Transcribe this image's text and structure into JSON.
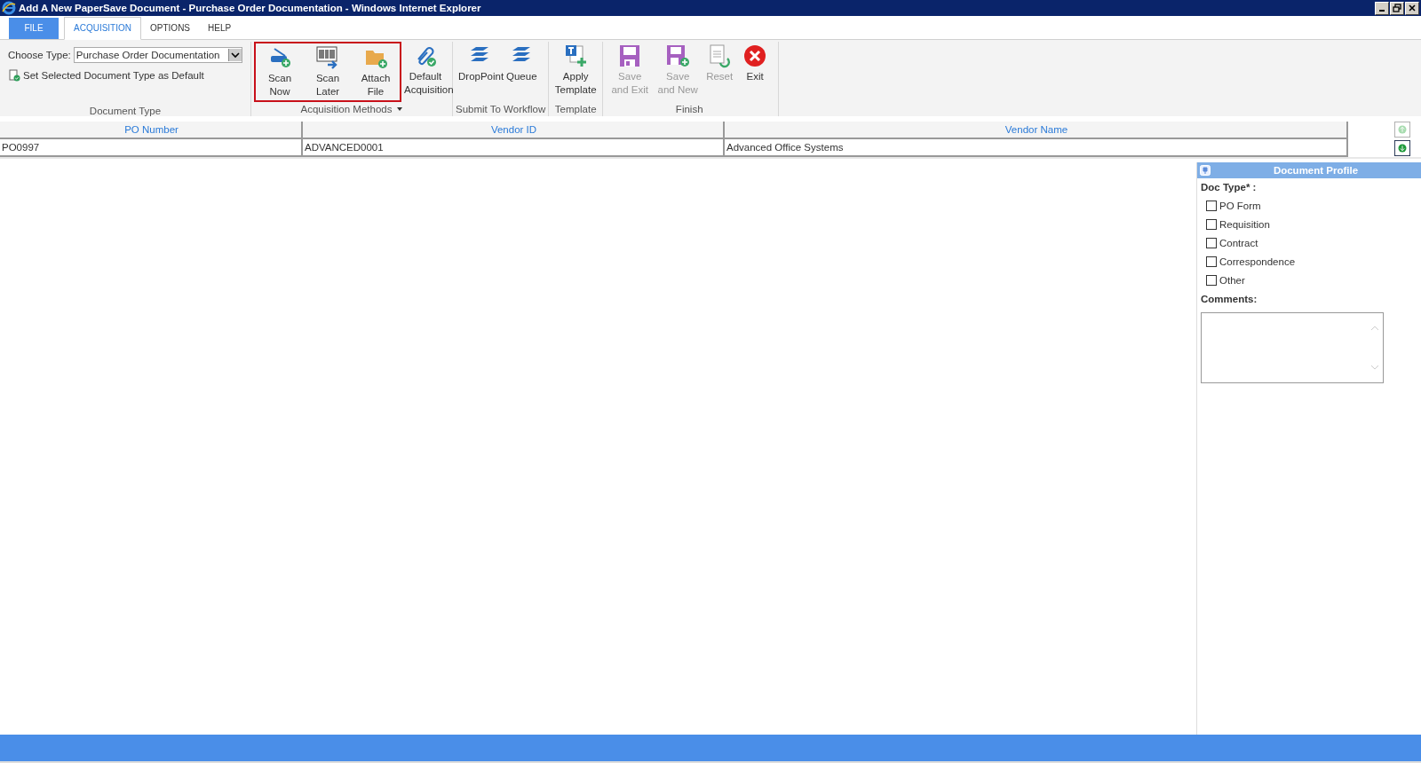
{
  "window": {
    "title": "Add A New PaperSave Document - Purchase Order Documentation - Windows Internet Explorer"
  },
  "tabs": [
    {
      "label": "FILE",
      "kind": "file",
      "selected": false
    },
    {
      "label": "ACQUISITION",
      "kind": "tab",
      "selected": true
    },
    {
      "label": "OPTIONS",
      "kind": "tab",
      "selected": false
    },
    {
      "label": "HELP",
      "kind": "tab",
      "selected": false
    }
  ],
  "document_type": {
    "choose_label": "Choose Type:",
    "choose_value": "Purchase Order Documentation",
    "default_label": "Set Selected Document Type as Default",
    "group_label": "Document Type"
  },
  "ribbon_groups": [
    {
      "label": "Acquisition Methods",
      "has_menu": true,
      "buttons": [
        {
          "label": "Scan Now",
          "kind": "scanner",
          "disabled": false,
          "highlighted": true
        },
        {
          "label": "Scan Later",
          "kind": "barcode",
          "disabled": false,
          "highlighted": true
        },
        {
          "label": "Attach File",
          "kind": "folder",
          "disabled": false,
          "highlighted": true
        },
        {
          "label": "Default Acquisition",
          "kind": "paperclip",
          "disabled": false,
          "highlighted": false
        }
      ]
    },
    {
      "label": "Submit To Workflow",
      "buttons": [
        {
          "label": "DropPoint",
          "kind": "layers",
          "disabled": false,
          "highlighted": false
        },
        {
          "label": "Queue",
          "kind": "layers",
          "disabled": false,
          "highlighted": false
        }
      ]
    },
    {
      "label": "Template",
      "buttons": [
        {
          "label": "Apply Template",
          "kind": "template",
          "disabled": false,
          "highlighted": false
        }
      ]
    },
    {
      "label": "Finish",
      "buttons": [
        {
          "label": "Save and Exit",
          "kind": "save",
          "disabled": true,
          "highlighted": false
        },
        {
          "label": "Save and New",
          "kind": "savenew",
          "disabled": true,
          "highlighted": false
        },
        {
          "label": "Reset",
          "kind": "reset",
          "disabled": true,
          "highlighted": false
        },
        {
          "label": "Exit",
          "kind": "exit",
          "disabled": false,
          "highlighted": false
        }
      ]
    }
  ],
  "table": {
    "columns": [
      "PO Number",
      "Vendor ID",
      "Vendor Name"
    ],
    "rows": [
      [
        "PO0997",
        "ADVANCED0001",
        "Advanced Office Systems"
      ]
    ]
  },
  "document_profile": {
    "title": "Document Profile",
    "doc_type_label": "Doc Type* :",
    "options": [
      {
        "label": "PO Form",
        "checked": false
      },
      {
        "label": "Requisition",
        "checked": false
      },
      {
        "label": "Contract",
        "checked": false
      },
      {
        "label": "Correspondence",
        "checked": false
      },
      {
        "label": "Other",
        "checked": false
      }
    ],
    "comments_label": "Comments:"
  }
}
